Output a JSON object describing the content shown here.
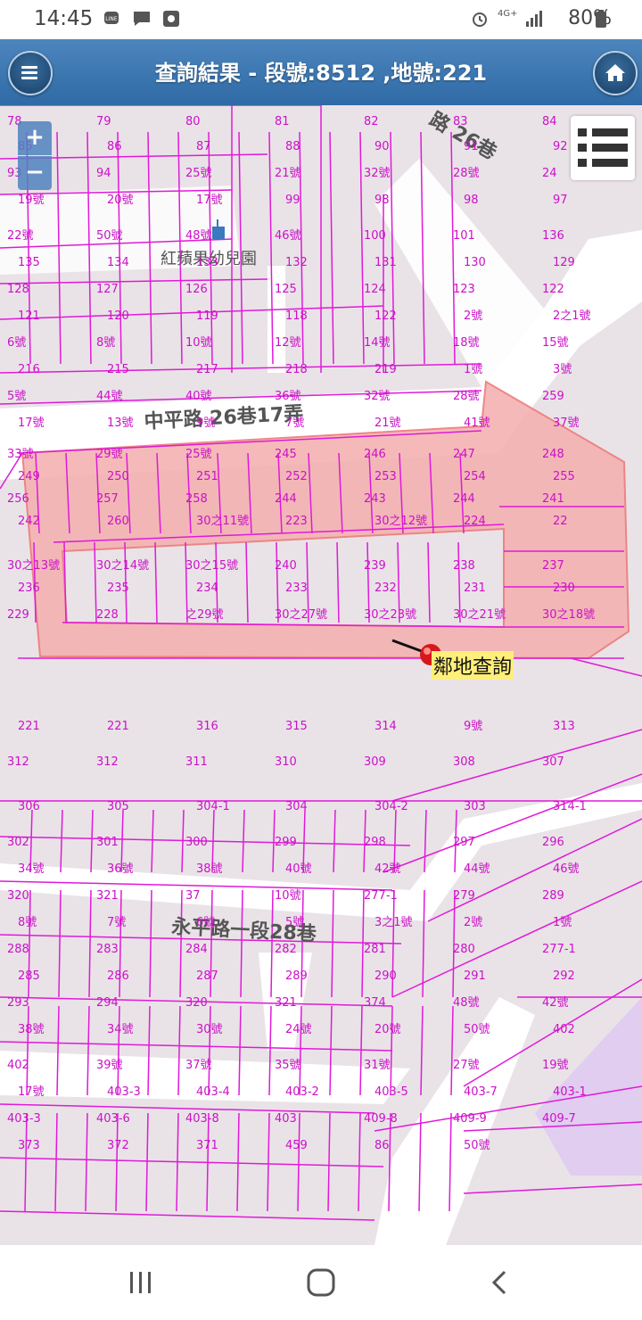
{
  "status_bar": {
    "time": "14:45",
    "network": "4G+",
    "battery": "80%",
    "icons": [
      "line-app-icon",
      "chat-icon",
      "media-icon",
      "alarm-icon",
      "signal-icon",
      "battery-icon"
    ]
  },
  "header": {
    "title": "查詢結果 - 段號:8512 ,地號:221",
    "menu_icon": "hamburger-icon",
    "home_icon": "home-icon"
  },
  "map": {
    "zoom_in": "+",
    "zoom_out": "−",
    "layer_icon": "layer-list-icon",
    "neighbor_query": "鄰地查詢",
    "school_label": "紅蘋果幼兒園",
    "roads": [
      "中平路 26巷17弄",
      "永平路一段28巷",
      "路 26巷"
    ],
    "colors": {
      "parcel_line": "#e01ad8",
      "selected_fill": "#f4b2b2",
      "pin": "#d81818",
      "base": "#e9e3e7",
      "road": "#ffffff"
    },
    "parcel_labels": [
      "78",
      "79",
      "80",
      "81",
      "82",
      "83",
      "84",
      "85",
      "86",
      "87",
      "88",
      "90",
      "91",
      "92",
      "93",
      "94",
      "25號",
      "21號",
      "32號",
      "28號",
      "24",
      "19號",
      "20號",
      "17號",
      "99",
      "98",
      "98",
      "97",
      "22號",
      "50號",
      "48號",
      "46號",
      "100",
      "101",
      "136",
      "135",
      "134",
      "133",
      "132",
      "131",
      "130",
      "129",
      "128",
      "127",
      "126",
      "125",
      "124",
      "123",
      "122",
      "121",
      "120",
      "119",
      "118",
      "122",
      "2號",
      "2之1號",
      "6號",
      "8號",
      "10號",
      "12號",
      "14號",
      "18號",
      "15號",
      "216",
      "215",
      "217",
      "218",
      "219",
      "1號",
      "3號",
      "5號",
      "44號",
      "40號",
      "36號",
      "32號",
      "28號",
      "259",
      "17號",
      "13號",
      "9號",
      "7號",
      "21號",
      "41號",
      "37號",
      "33號",
      "29號",
      "25號",
      "245",
      "246",
      "247",
      "248",
      "249",
      "250",
      "251",
      "252",
      "253",
      "254",
      "255",
      "256",
      "257",
      "258",
      "244",
      "243",
      "244",
      "241",
      "242",
      "260",
      "30之11號",
      "223",
      "30之12號",
      "224",
      "22",
      "30之13號",
      "30之14號",
      "30之15號",
      "240",
      "239",
      "238",
      "237",
      "236",
      "235",
      "234",
      "233",
      "232",
      "231",
      "230",
      "229",
      "228",
      "之29號",
      "30之27號",
      "30之23號",
      "30之21號",
      "30之18號",
      "221",
      "221",
      "316",
      "315",
      "314",
      "9號",
      "313",
      "312",
      "312",
      "311",
      "310",
      "309",
      "308",
      "307",
      "306",
      "305",
      "304-1",
      "304",
      "304-2",
      "303",
      "314-1",
      "302",
      "301",
      "300",
      "299",
      "298",
      "297",
      "296",
      "34號",
      "36號",
      "38號",
      "40號",
      "42號",
      "44號",
      "46號",
      "320",
      "321",
      "37",
      "10號",
      "277-1",
      "279",
      "289",
      "8號",
      "7號",
      "6號",
      "5號",
      "3之1號",
      "2號",
      "1號",
      "288",
      "283",
      "284",
      "282",
      "281",
      "280",
      "277-1",
      "285",
      "286",
      "287",
      "289",
      "290",
      "291",
      "292",
      "293",
      "294",
      "320",
      "321",
      "374",
      "48號",
      "42號",
      "38號",
      "34號",
      "30號",
      "24號",
      "20號",
      "50號",
      "402",
      "402",
      "39號",
      "37號",
      "35號",
      "31號",
      "27號",
      "19號",
      "17號",
      "403-3",
      "403-4",
      "403-2",
      "403-5",
      "403-7",
      "403-1",
      "403-3",
      "403-6",
      "403-8",
      "403",
      "409-8",
      "409-9",
      "409-7",
      "373",
      "372",
      "371",
      "459",
      "86",
      "50號"
    ]
  },
  "nav_bar": {
    "recent_icon": "recent-apps-icon",
    "home_icon": "home-circle-icon",
    "back_icon": "back-icon"
  }
}
